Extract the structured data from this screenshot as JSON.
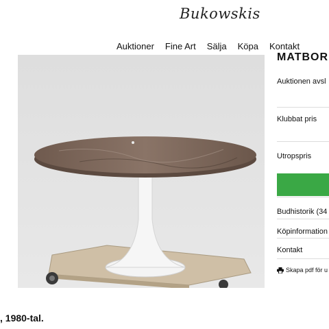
{
  "site": {
    "logo_text": "Bukowskis"
  },
  "nav": {
    "items": [
      "Auktioner",
      "Fine Art",
      "Sälja",
      "Köpa",
      "Kontakt"
    ]
  },
  "product": {
    "title_partial": "MATBORD",
    "caption_partial": ", 1980-tal.",
    "image_alt": "Marble-top tulip dining table on wooden dolly"
  },
  "sidebar": {
    "auction_status": "Auktionen avsl",
    "hammer_price_label": "Klubbat pris",
    "estimate_label": "Utropspris",
    "bid_history": "Budhistorik (34",
    "purchase_info": "Köpinformation",
    "contact": "Kontakt",
    "pdf_label": "Skapa pdf för u",
    "bid_button_color": "#3aa845"
  }
}
